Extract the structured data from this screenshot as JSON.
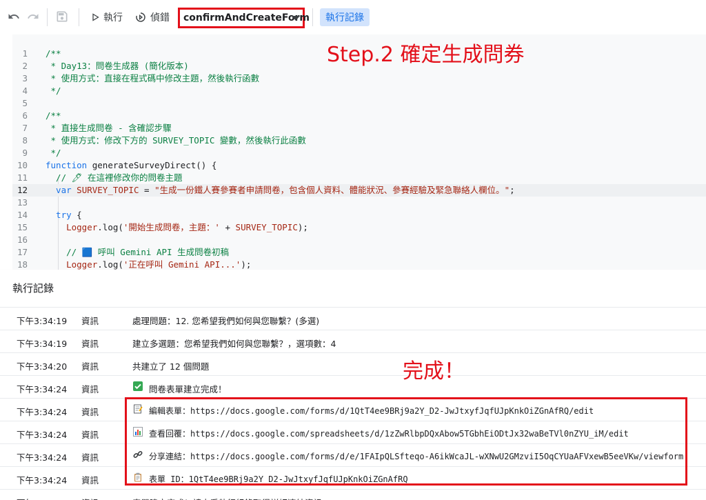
{
  "toolbar": {
    "undo_icon": "undo-icon",
    "redo_icon": "redo-icon",
    "save_icon": "save-icon",
    "run_label": "執行",
    "debug_label": "偵錯",
    "function_select_value": "confirmAndCreateForm",
    "execution_log_label": "執行記錄"
  },
  "editor": {
    "lines": [
      {
        "n": "1",
        "parts": [
          {
            "c": "cmt",
            "t": "/**"
          }
        ]
      },
      {
        "n": "2",
        "parts": [
          {
            "c": "cmt",
            "t": " * Day13：問卷生成器 (簡化版本)"
          }
        ]
      },
      {
        "n": "3",
        "parts": [
          {
            "c": "cmt",
            "t": " * 使用方式：直接在程式碼中修改主題，然後執行函數"
          }
        ]
      },
      {
        "n": "4",
        "parts": [
          {
            "c": "cmt",
            "t": " */"
          }
        ]
      },
      {
        "n": "5",
        "parts": []
      },
      {
        "n": "6",
        "parts": [
          {
            "c": "cmt",
            "t": "/**"
          }
        ]
      },
      {
        "n": "7",
        "parts": [
          {
            "c": "cmt",
            "t": " * 直接生成問卷 - 含確認步驟"
          }
        ]
      },
      {
        "n": "8",
        "parts": [
          {
            "c": "cmt",
            "t": " * 使用方式：修改下方的 SURVEY_TOPIC 變數，然後執行此函數"
          }
        ]
      },
      {
        "n": "9",
        "parts": [
          {
            "c": "cmt",
            "t": " */"
          }
        ]
      },
      {
        "n": "10",
        "parts": [
          {
            "c": "kw",
            "t": "function"
          },
          {
            "c": "plain",
            "t": " generateSurveyDirect() {"
          }
        ]
      },
      {
        "n": "11",
        "parts": [
          {
            "c": "cmt",
            "t": "  // 🖊 在這裡修改你的問卷主題"
          }
        ]
      },
      {
        "n": "12",
        "parts": [
          {
            "c": "kw",
            "t": "  var"
          },
          {
            "c": "str",
            "t": " SURVEY_TOPIC"
          },
          {
            "c": "plain",
            "t": " = "
          },
          {
            "c": "str",
            "t": "\"生成一份鐵人賽參賽者申請問卷，包含個人資料、體能狀況、參賽經驗及緊急聯絡人欄位。\""
          },
          {
            "c": "plain",
            "t": ";"
          }
        ]
      },
      {
        "n": "13",
        "parts": []
      },
      {
        "n": "14",
        "parts": [
          {
            "c": "kw",
            "t": "  try"
          },
          {
            "c": "plain",
            "t": " {"
          }
        ]
      },
      {
        "n": "15",
        "parts": [
          {
            "c": "str",
            "t": "    Logger"
          },
          {
            "c": "plain",
            "t": ".log("
          },
          {
            "c": "str",
            "t": "'開始生成問卷，主題：'"
          },
          {
            "c": "plain",
            "t": " + "
          },
          {
            "c": "str",
            "t": "SURVEY_TOPIC"
          },
          {
            "c": "plain",
            "t": ");"
          }
        ]
      },
      {
        "n": "16",
        "parts": []
      },
      {
        "n": "17",
        "parts": [
          {
            "c": "cmt",
            "t": "    // 🟦 呼叫 Gemini API 生成問卷初稿"
          }
        ]
      },
      {
        "n": "18",
        "parts": [
          {
            "c": "str",
            "t": "    Logger"
          },
          {
            "c": "plain",
            "t": ".log("
          },
          {
            "c": "str",
            "t": "'正在呼叫 Gemini API...'"
          },
          {
            "c": "plain",
            "t": ");"
          }
        ]
      }
    ]
  },
  "annotations": {
    "step2": "Step.2 確定生成問券",
    "done": "完成！"
  },
  "log_panel": {
    "title": "執行記錄",
    "rows": [
      {
        "time": "下午3:34:19",
        "level": "資訊",
        "icon": "",
        "message": "處理問題：12. 您希望我們如何與您聯繫？(多選)"
      },
      {
        "time": "下午3:34:19",
        "level": "資訊",
        "icon": "",
        "message": "建立多選題：您希望我們如何與您聯繫？，選項數：4"
      },
      {
        "time": "下午3:34:20",
        "level": "資訊",
        "icon": "",
        "message": "共建立了 12 個問題"
      },
      {
        "time": "下午3:34:24",
        "level": "資訊",
        "icon": "check-mark-icon",
        "message": "問卷表單建立完成！"
      },
      {
        "time": "下午3:34:24",
        "level": "資訊",
        "icon": "memo-icon",
        "message": "編輯表單：https://docs.google.com/forms/d/1QtT4ee9BRj9a2Y_D2-JwJtxyfJqfUJpKnkOiZGnAfRQ/edit"
      },
      {
        "time": "下午3:34:24",
        "level": "資訊",
        "icon": "bar-chart-icon",
        "message": "查看回覆：https://docs.google.com/spreadsheets/d/1zZwRlbpDQxAbow5TGbhEiODtJx32waBeTVl0nZYU_iM/edit"
      },
      {
        "time": "下午3:34:24",
        "level": "資訊",
        "icon": "link-icon",
        "message": "分享連結：https://docs.google.com/forms/d/e/1FAIpQLSfteqo-A6ikWcaJL-wXNwU2GMzviI5OqCYUaAFVxewB5eeVKw/viewform"
      },
      {
        "time": "下午3:34:24",
        "level": "資訊",
        "icon": "clipboard-icon",
        "message": "表單 ID：1QtT4ee9BRj9a2Y_D2-JwJtxyfJqfUJpKnkOiZGnAfRQ"
      },
      {
        "time": "下午3:34:24",
        "level": "資訊",
        "icon": "",
        "message": "表單建立完成！請查看執行紀錄取得詳細連結資訊。"
      }
    ]
  }
}
